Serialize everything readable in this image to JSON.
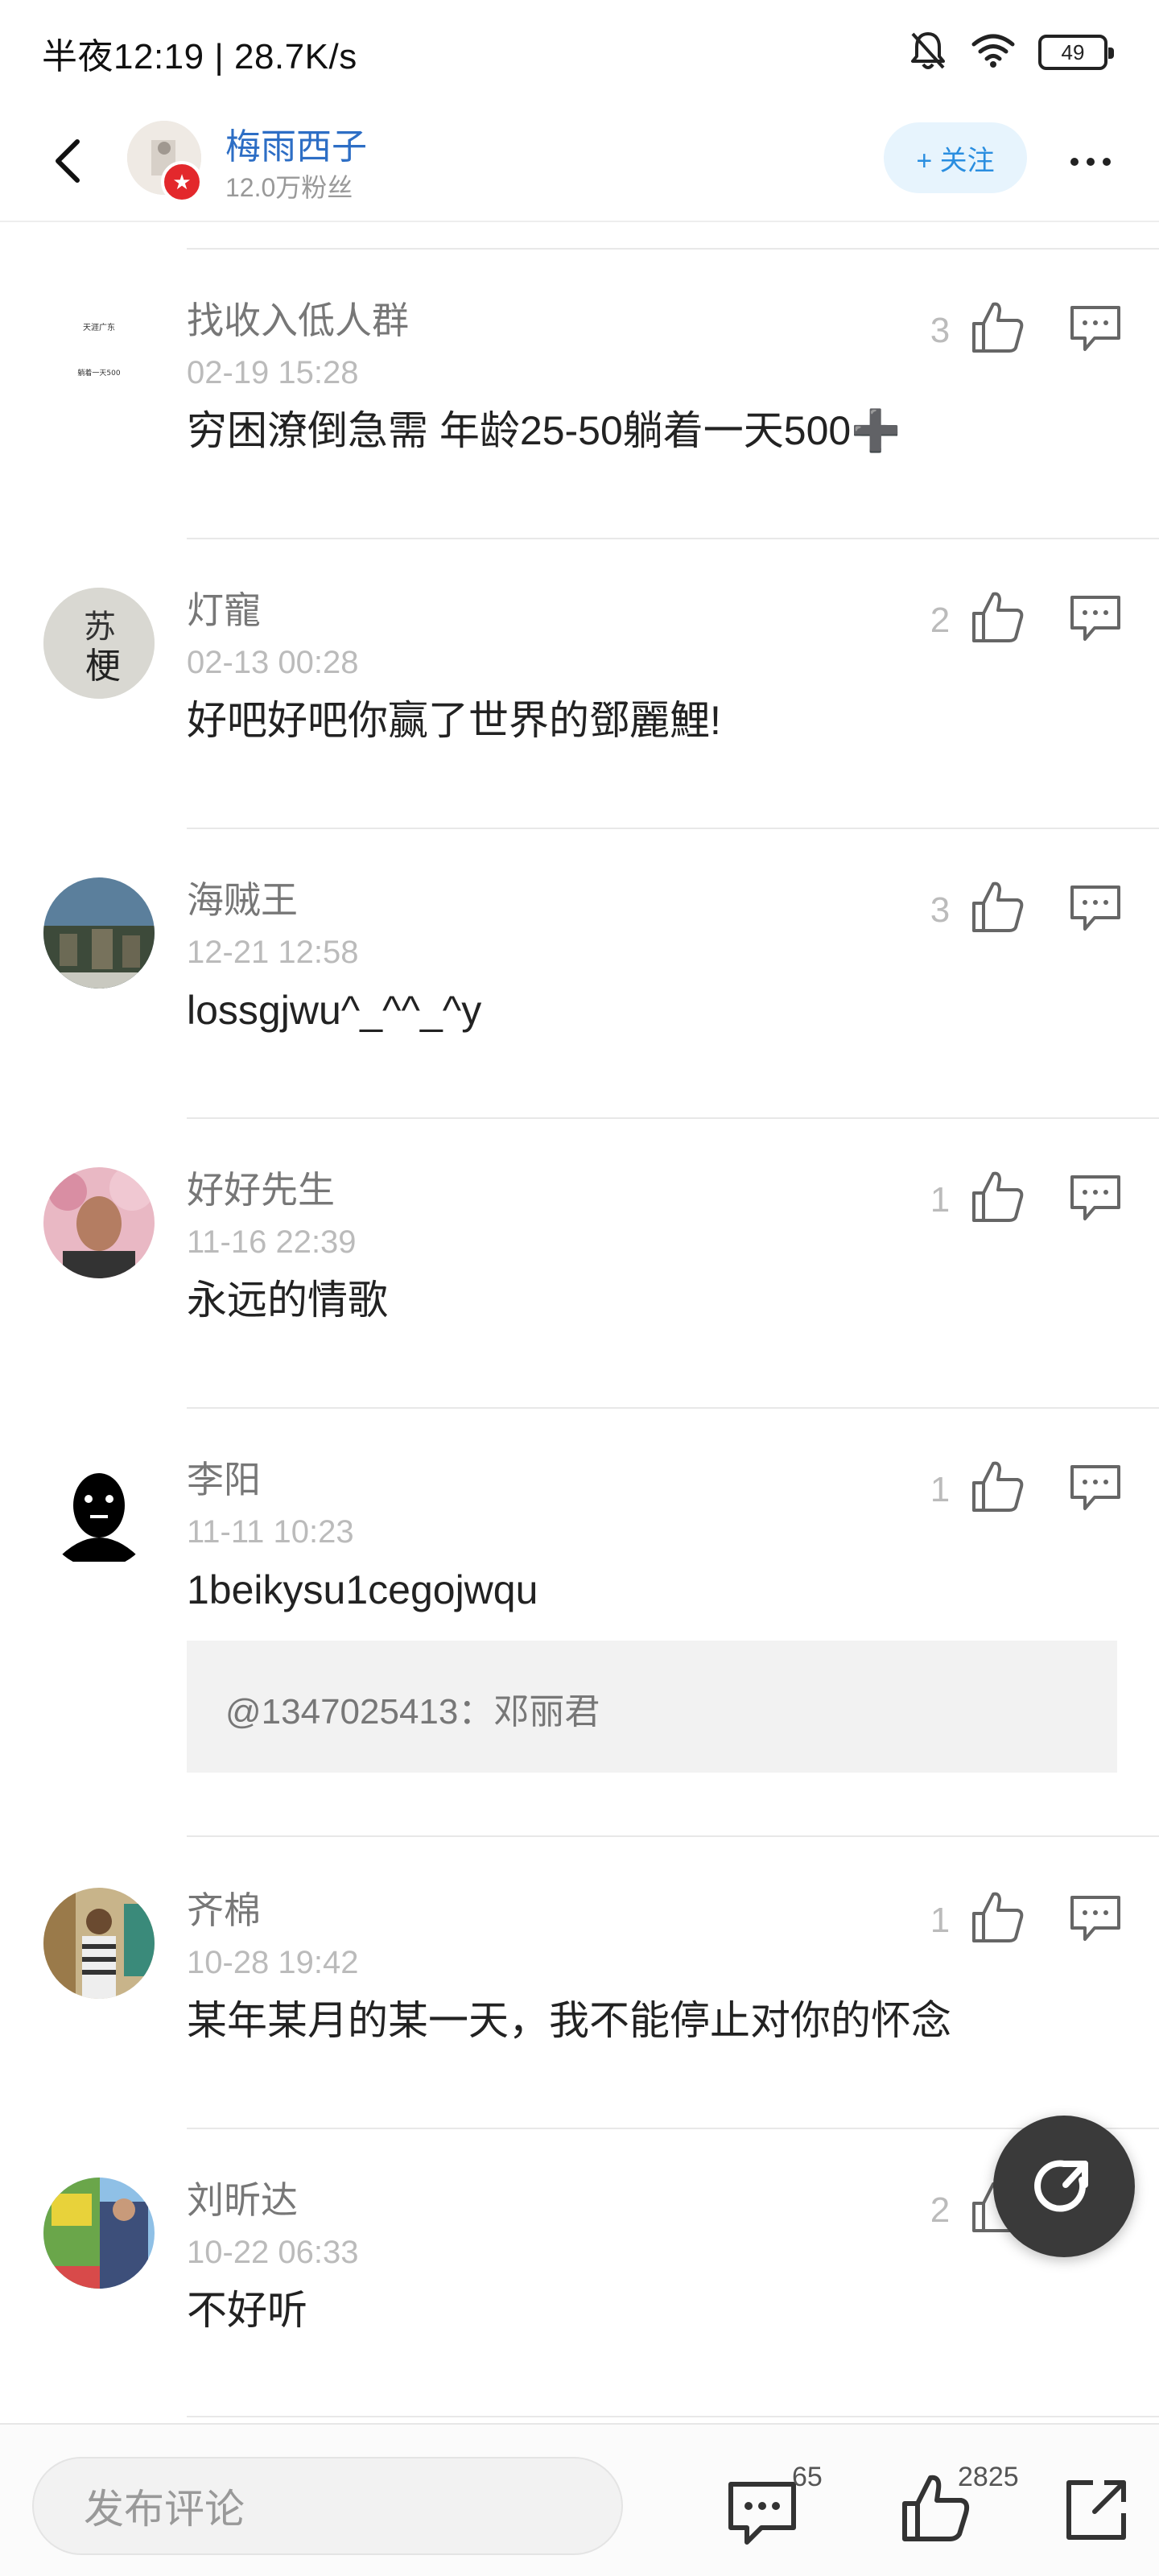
{
  "status_bar": {
    "time_label": "半夜12:19 | 28.7K/s",
    "battery_level": "49",
    "icons": [
      "bell-muted-icon",
      "wifi-icon",
      "battery-icon"
    ]
  },
  "header": {
    "back_icon": "chevron-left-icon",
    "author_name": "梅雨西子",
    "fans": "12.0万粉丝",
    "follow_label": "+ 关注",
    "more_icon": "more-dots-icon"
  },
  "comments": [
    {
      "name": "找收入低人群",
      "time": "02-19 15:28",
      "text": "穷困潦倒急需 年龄25-50躺着一天500➕",
      "likes": "3",
      "avatar_text": [
        "天涯广东",
        "躺着一天500"
      ]
    },
    {
      "name": "灯寵",
      "time": "02-13 00:28",
      "text": "好吧好吧你赢了世界的鄧麗鯉!",
      "likes": "2",
      "avatar_text": [
        "苏",
        "梗"
      ]
    },
    {
      "name": "海贼王",
      "time": "12-21 12:58",
      "text": "lossgjwu^_^^_^y",
      "likes": "3"
    },
    {
      "name": "好好先生",
      "time": "11-16 22:39",
      "text": "永远的情歌",
      "likes": "1"
    },
    {
      "name": "李阳",
      "time": "11-11 10:23",
      "text": "1beikysu1cegojwqu",
      "likes": "1",
      "quote": "@1347025413：邓丽君"
    },
    {
      "name": "齐棉",
      "time": "10-28 19:42",
      "text": "某年某月的某一天，我不能停止对你的怀念",
      "likes": "1"
    },
    {
      "name": "刘昕达",
      "time": "10-22 06:33",
      "text": "不好听",
      "likes": "2"
    }
  ],
  "bottom_bar": {
    "input_placeholder": "发布评论",
    "comment_count": "65",
    "like_count": "2825"
  },
  "colors": {
    "accent": "#2d6ec5",
    "follow_bg": "#e7f4fd",
    "follow_text": "#2a8ee0",
    "badge_red": "#e3282c"
  }
}
